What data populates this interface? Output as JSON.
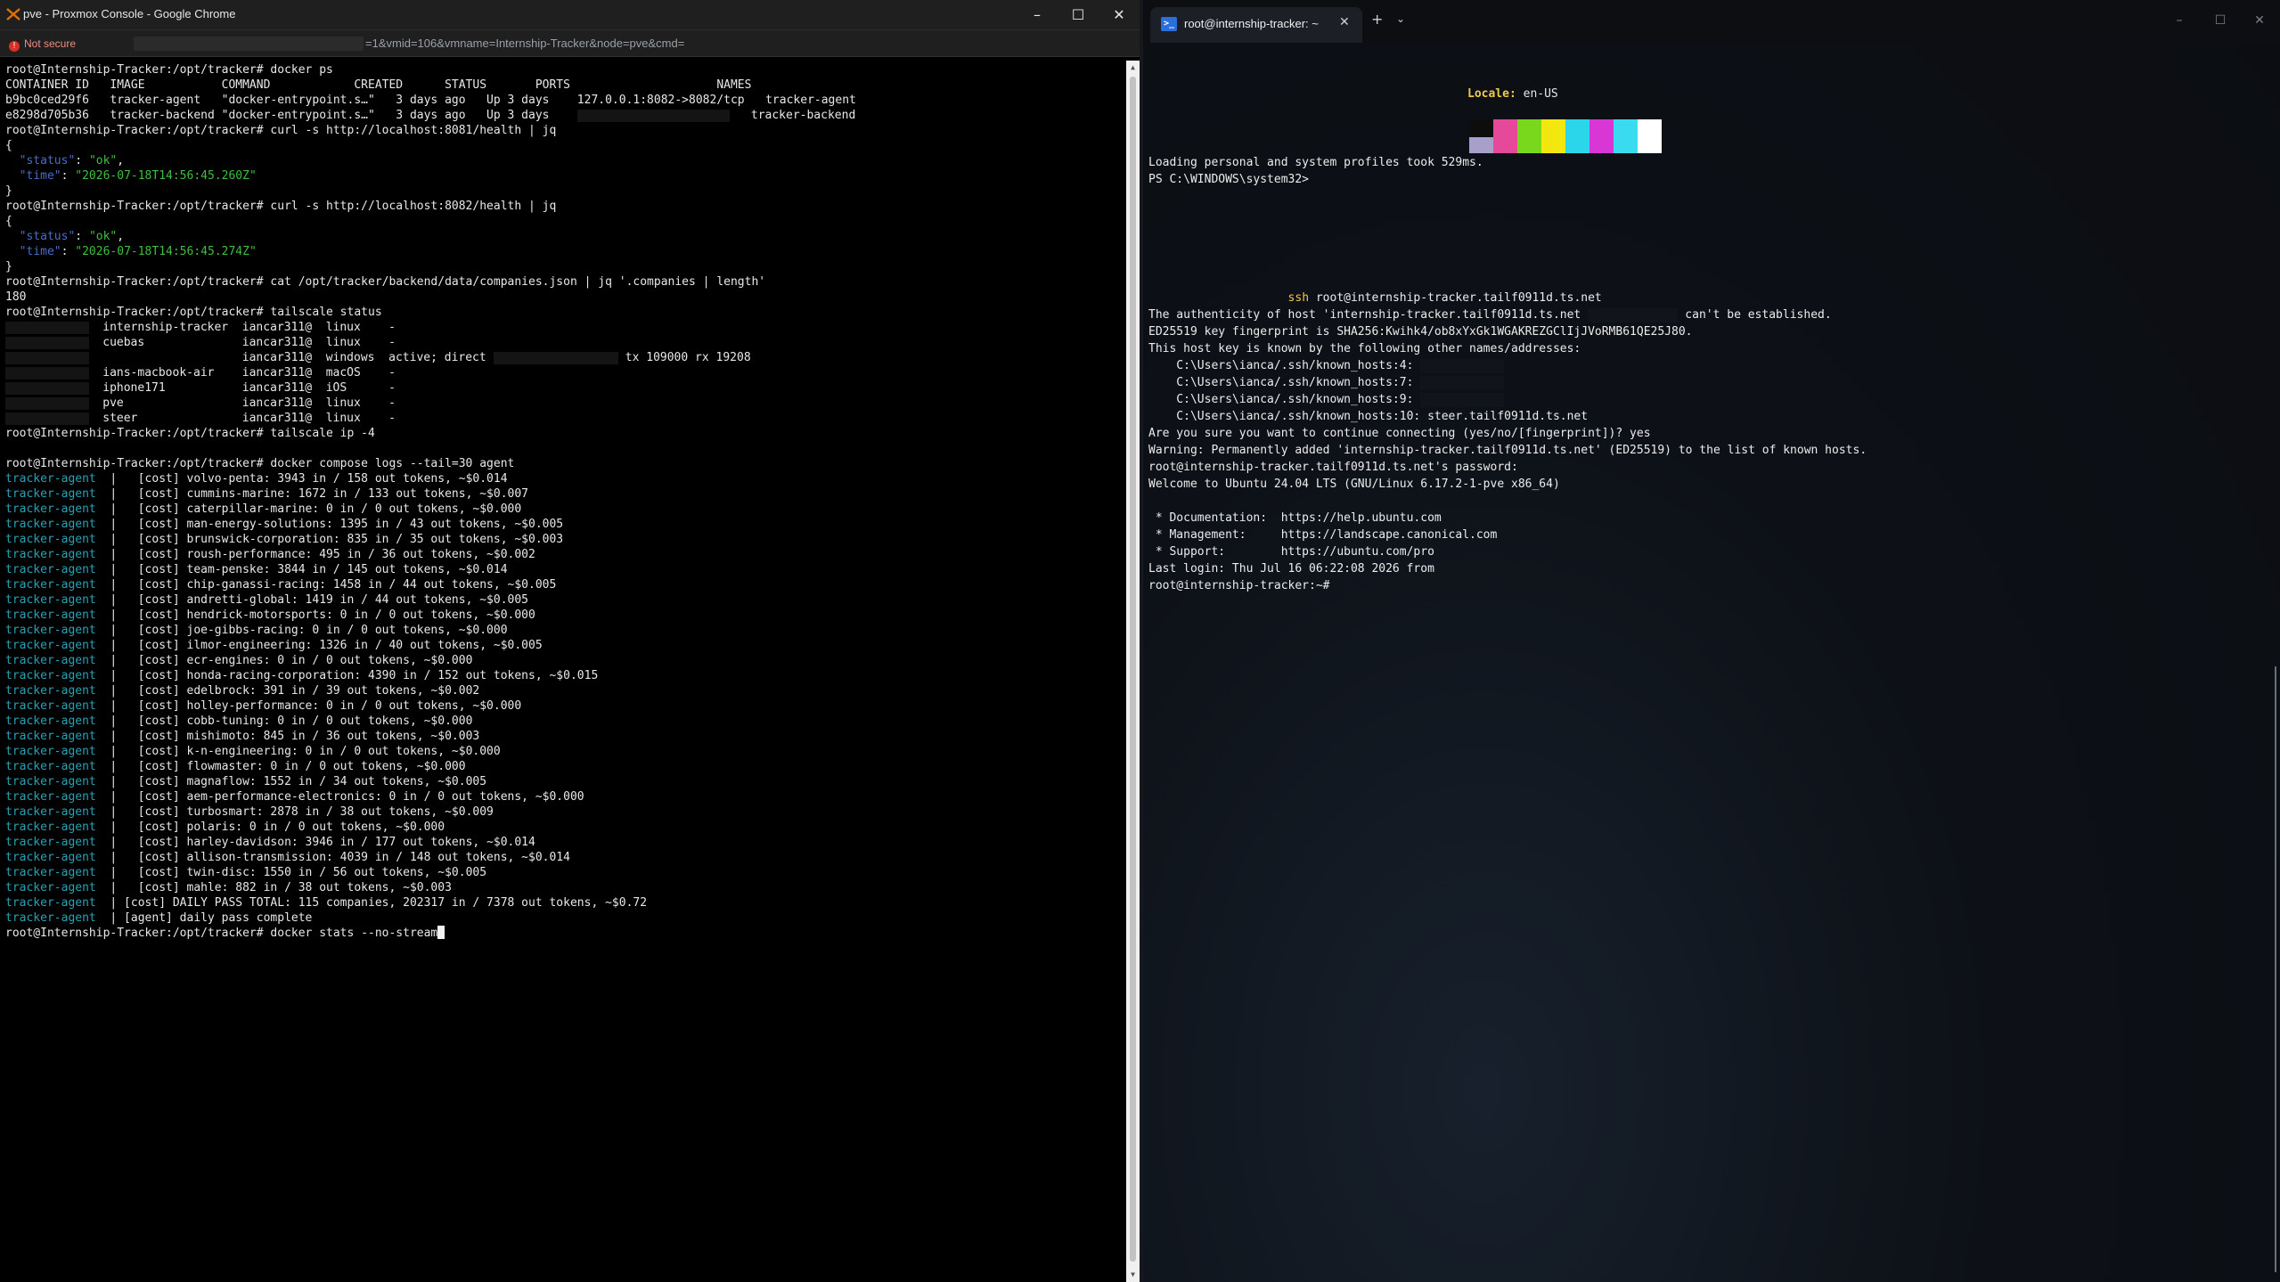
{
  "chrome": {
    "window_title": "pve - Proxmox Console - Google Chrome",
    "not_secure": "Not secure",
    "url_visible": "=1&vmid=106&vmname=Internship-Tracker&node=pve&cmd="
  },
  "console": {
    "lines": [
      {
        "segs": [
          {
            "t": "root@Internship-Tracker:/opt/tracker# docker ps"
          }
        ]
      },
      {
        "segs": [
          {
            "t": "CONTAINER ID   IMAGE           COMMAND            CREATED      STATUS       PORTS                     NAMES"
          }
        ]
      },
      {
        "segs": [
          {
            "t": "b9bc0ced29f6   tracker-agent   \"docker-entrypoint.s…\"   3 days ago   Up 3 days    127.0.0.1:8082->8082/tcp   tracker-agent"
          }
        ]
      },
      {
        "segs": [
          {
            "t": "e8298d705b36   tracker-backend \"docker-entrypoint.s…\"   3 days ago   Up 3 days    "
          },
          {
            "mask": 22
          },
          {
            "t": "   tracker-backend"
          }
        ]
      },
      {
        "segs": [
          {
            "t": "root@Internship-Tracker:/opt/tracker# curl -s http://localhost:8081/health | jq"
          }
        ]
      },
      {
        "segs": [
          {
            "t": "{"
          }
        ]
      },
      {
        "segs": [
          {
            "t": "  "
          },
          {
            "t": "\"status\"",
            "c": "jkey"
          },
          {
            "t": ": "
          },
          {
            "t": "\"ok\"",
            "c": "jstr"
          },
          {
            "t": ","
          }
        ]
      },
      {
        "segs": [
          {
            "t": "  "
          },
          {
            "t": "\"time\"",
            "c": "jkey"
          },
          {
            "t": ": "
          },
          {
            "t": "\"2026-07-18T14:56:45.260Z\"",
            "c": "jstr"
          }
        ]
      },
      {
        "segs": [
          {
            "t": "}"
          }
        ]
      },
      {
        "segs": [
          {
            "t": "root@Internship-Tracker:/opt/tracker# curl -s http://localhost:8082/health | jq"
          }
        ]
      },
      {
        "segs": [
          {
            "t": "{"
          }
        ]
      },
      {
        "segs": [
          {
            "t": "  "
          },
          {
            "t": "\"status\"",
            "c": "jkey"
          },
          {
            "t": ": "
          },
          {
            "t": "\"ok\"",
            "c": "jstr"
          },
          {
            "t": ","
          }
        ]
      },
      {
        "segs": [
          {
            "t": "  "
          },
          {
            "t": "\"time\"",
            "c": "jkey"
          },
          {
            "t": ": "
          },
          {
            "t": "\"2026-07-18T14:56:45.274Z\"",
            "c": "jstr"
          }
        ]
      },
      {
        "segs": [
          {
            "t": "}"
          }
        ]
      },
      {
        "segs": [
          {
            "t": "root@Internship-Tracker:/opt/tracker# cat /opt/tracker/backend/data/companies.json | jq '.companies | length'"
          }
        ]
      },
      {
        "segs": [
          {
            "t": "180"
          }
        ]
      },
      {
        "segs": [
          {
            "t": "root@Internship-Tracker:/opt/tracker# tailscale status"
          }
        ]
      },
      {
        "segs": [
          {
            "mask": 12
          },
          {
            "t": "  internship-tracker  iancar311@  linux    -"
          }
        ]
      },
      {
        "segs": [
          {
            "mask": 12
          },
          {
            "t": "  cuebas              iancar311@  linux    -"
          }
        ]
      },
      {
        "segs": [
          {
            "mask": 12
          },
          {
            "t": "                      iancar311@  windows  active; direct "
          },
          {
            "mask": 18
          },
          {
            "t": " tx 109000 rx 19208"
          }
        ]
      },
      {
        "segs": [
          {
            "mask": 12
          },
          {
            "t": "  ians-macbook-air    iancar311@  macOS    -"
          }
        ]
      },
      {
        "segs": [
          {
            "mask": 12
          },
          {
            "t": "  iphone171           iancar311@  iOS      -"
          }
        ]
      },
      {
        "segs": [
          {
            "mask": 12
          },
          {
            "t": "  pve                 iancar311@  linux    -"
          }
        ]
      },
      {
        "segs": [
          {
            "mask": 12
          },
          {
            "t": "  steer               iancar311@  linux    -"
          }
        ]
      },
      {
        "segs": [
          {
            "t": "root@Internship-Tracker:/opt/tracker# tailscale ip -4"
          }
        ]
      },
      {
        "segs": [
          {
            "t": ""
          }
        ]
      },
      {
        "segs": [
          {
            "t": "root@Internship-Tracker:/opt/tracker# docker compose logs --tail=30 agent"
          }
        ]
      },
      {
        "segs": [
          {
            "t": "tracker-agent",
            "c": "agent"
          },
          {
            "t": "  |   [cost] volvo-penta: 3943 in / 158 out tokens, ~$0.014"
          }
        ]
      },
      {
        "segs": [
          {
            "t": "tracker-agent",
            "c": "agent"
          },
          {
            "t": "  |   [cost] cummins-marine: 1672 in / 133 out tokens, ~$0.007"
          }
        ]
      },
      {
        "segs": [
          {
            "t": "tracker-agent",
            "c": "agent"
          },
          {
            "t": "  |   [cost] caterpillar-marine: 0 in / 0 out tokens, ~$0.000"
          }
        ]
      },
      {
        "segs": [
          {
            "t": "tracker-agent",
            "c": "agent"
          },
          {
            "t": "  |   [cost] man-energy-solutions: 1395 in / 43 out tokens, ~$0.005"
          }
        ]
      },
      {
        "segs": [
          {
            "t": "tracker-agent",
            "c": "agent"
          },
          {
            "t": "  |   [cost] brunswick-corporation: 835 in / 35 out tokens, ~$0.003"
          }
        ]
      },
      {
        "segs": [
          {
            "t": "tracker-agent",
            "c": "agent"
          },
          {
            "t": "  |   [cost] roush-performance: 495 in / 36 out tokens, ~$0.002"
          }
        ]
      },
      {
        "segs": [
          {
            "t": "tracker-agent",
            "c": "agent"
          },
          {
            "t": "  |   [cost] team-penske: 3844 in / 145 out tokens, ~$0.014"
          }
        ]
      },
      {
        "segs": [
          {
            "t": "tracker-agent",
            "c": "agent"
          },
          {
            "t": "  |   [cost] chip-ganassi-racing: 1458 in / 44 out tokens, ~$0.005"
          }
        ]
      },
      {
        "segs": [
          {
            "t": "tracker-agent",
            "c": "agent"
          },
          {
            "t": "  |   [cost] andretti-global: 1419 in / 44 out tokens, ~$0.005"
          }
        ]
      },
      {
        "segs": [
          {
            "t": "tracker-agent",
            "c": "agent"
          },
          {
            "t": "  |   [cost] hendrick-motorsports: 0 in / 0 out tokens, ~$0.000"
          }
        ]
      },
      {
        "segs": [
          {
            "t": "tracker-agent",
            "c": "agent"
          },
          {
            "t": "  |   [cost] joe-gibbs-racing: 0 in / 0 out tokens, ~$0.000"
          }
        ]
      },
      {
        "segs": [
          {
            "t": "tracker-agent",
            "c": "agent"
          },
          {
            "t": "  |   [cost] ilmor-engineering: 1326 in / 40 out tokens, ~$0.005"
          }
        ]
      },
      {
        "segs": [
          {
            "t": "tracker-agent",
            "c": "agent"
          },
          {
            "t": "  |   [cost] ecr-engines: 0 in / 0 out tokens, ~$0.000"
          }
        ]
      },
      {
        "segs": [
          {
            "t": "tracker-agent",
            "c": "agent"
          },
          {
            "t": "  |   [cost] honda-racing-corporation: 4390 in / 152 out tokens, ~$0.015"
          }
        ]
      },
      {
        "segs": [
          {
            "t": "tracker-agent",
            "c": "agent"
          },
          {
            "t": "  |   [cost] edelbrock: 391 in / 39 out tokens, ~$0.002"
          }
        ]
      },
      {
        "segs": [
          {
            "t": "tracker-agent",
            "c": "agent"
          },
          {
            "t": "  |   [cost] holley-performance: 0 in / 0 out tokens, ~$0.000"
          }
        ]
      },
      {
        "segs": [
          {
            "t": "tracker-agent",
            "c": "agent"
          },
          {
            "t": "  |   [cost] cobb-tuning: 0 in / 0 out tokens, ~$0.000"
          }
        ]
      },
      {
        "segs": [
          {
            "t": "tracker-agent",
            "c": "agent"
          },
          {
            "t": "  |   [cost] mishimoto: 845 in / 36 out tokens, ~$0.003"
          }
        ]
      },
      {
        "segs": [
          {
            "t": "tracker-agent",
            "c": "agent"
          },
          {
            "t": "  |   [cost] k-n-engineering: 0 in / 0 out tokens, ~$0.000"
          }
        ]
      },
      {
        "segs": [
          {
            "t": "tracker-agent",
            "c": "agent"
          },
          {
            "t": "  |   [cost] flowmaster: 0 in / 0 out tokens, ~$0.000"
          }
        ]
      },
      {
        "segs": [
          {
            "t": "tracker-agent",
            "c": "agent"
          },
          {
            "t": "  |   [cost] magnaflow: 1552 in / 34 out tokens, ~$0.005"
          }
        ]
      },
      {
        "segs": [
          {
            "t": "tracker-agent",
            "c": "agent"
          },
          {
            "t": "  |   [cost] aem-performance-electronics: 0 in / 0 out tokens, ~$0.000"
          }
        ]
      },
      {
        "segs": [
          {
            "t": "tracker-agent",
            "c": "agent"
          },
          {
            "t": "  |   [cost] turbosmart: 2878 in / 38 out tokens, ~$0.009"
          }
        ]
      },
      {
        "segs": [
          {
            "t": "tracker-agent",
            "c": "agent"
          },
          {
            "t": "  |   [cost] polaris: 0 in / 0 out tokens, ~$0.000"
          }
        ]
      },
      {
        "segs": [
          {
            "t": "tracker-agent",
            "c": "agent"
          },
          {
            "t": "  |   [cost] harley-davidson: 3946 in / 177 out tokens, ~$0.014"
          }
        ]
      },
      {
        "segs": [
          {
            "t": "tracker-agent",
            "c": "agent"
          },
          {
            "t": "  |   [cost] allison-transmission: 4039 in / 148 out tokens, ~$0.014"
          }
        ]
      },
      {
        "segs": [
          {
            "t": "tracker-agent",
            "c": "agent"
          },
          {
            "t": "  |   [cost] twin-disc: 1550 in / 56 out tokens, ~$0.005"
          }
        ]
      },
      {
        "segs": [
          {
            "t": "tracker-agent",
            "c": "agent"
          },
          {
            "t": "  |   [cost] mahle: 882 in / 38 out tokens, ~$0.003"
          }
        ]
      },
      {
        "segs": [
          {
            "t": "tracker-agent",
            "c": "agent"
          },
          {
            "t": "  | [cost] DAILY PASS TOTAL: 115 companies, 202317 in / 7378 out tokens, ~$0.72"
          }
        ]
      },
      {
        "segs": [
          {
            "t": "tracker-agent",
            "c": "agent"
          },
          {
            "t": "  | [agent] daily pass complete"
          }
        ]
      },
      {
        "segs": [
          {
            "t": "root@Internship-Tracker:/opt/tracker# docker stats --no-stream"
          },
          {
            "cursor": true
          }
        ]
      }
    ]
  },
  "terminal": {
    "tab_title": "root@internship-tracker: ~",
    "tab_icon": "powershell-icon",
    "locale_label": "Locale:",
    "locale_value": "en-US",
    "swatch_colors": [
      "#0d0d0d",
      "#e6489a",
      "#7ad81c",
      "#f2e70f",
      "#2bd6ea",
      "#d837d6",
      "#39dcef",
      "#ffffff"
    ],
    "swatch_under": "#a8a0c8",
    "lines": [
      {
        "segs": [
          {
            "t": "Loading personal and system profiles took 529ms."
          }
        ]
      },
      {
        "segs": [
          {
            "t": "PS C:\\WINDOWS\\system32>"
          }
        ]
      },
      {
        "segs": [
          {
            "t": ""
          }
        ]
      },
      {
        "segs": [
          {
            "t": ""
          }
        ]
      },
      {
        "segs": [
          {
            "t": ""
          }
        ]
      },
      {
        "segs": [
          {
            "t": ""
          }
        ]
      },
      {
        "segs": [
          {
            "t": ""
          }
        ]
      },
      {
        "segs": [
          {
            "t": ""
          }
        ]
      },
      {
        "segs": [
          {
            "t": "                    "
          },
          {
            "t": "ssh",
            "c": "ssh-kw"
          },
          {
            "t": " root@internship-tracker.tailf0911d.ts.net"
          }
        ]
      },
      {
        "segs": [
          {
            "t": "The authenticity of host 'internship-tracker.tailf0911d.ts.net "
          },
          {
            "mask": 13
          },
          {
            "t": " can't be established."
          }
        ]
      },
      {
        "segs": [
          {
            "t": "ED25519 key fingerprint is SHA256:Kwihk4/ob8xYxGk1WGAKREZGClIjJVoRMB61QE25J80."
          }
        ]
      },
      {
        "segs": [
          {
            "t": "This host key is known by the following other names/addresses:"
          }
        ]
      },
      {
        "segs": [
          {
            "t": "    C:\\Users\\ianca/.ssh/known_hosts:4: "
          },
          {
            "mask": 12
          }
        ]
      },
      {
        "segs": [
          {
            "t": "    C:\\Users\\ianca/.ssh/known_hosts:7: "
          },
          {
            "mask": 12
          }
        ]
      },
      {
        "segs": [
          {
            "t": "    C:\\Users\\ianca/.ssh/known_hosts:9: "
          },
          {
            "mask": 12
          }
        ]
      },
      {
        "segs": [
          {
            "t": "    C:\\Users\\ianca/.ssh/known_hosts:10: steer.tailf0911d.ts.net"
          }
        ]
      },
      {
        "segs": [
          {
            "t": "Are you sure you want to continue connecting (yes/no/[fingerprint])? yes"
          }
        ]
      },
      {
        "segs": [
          {
            "t": "Warning: Permanently added 'internship-tracker.tailf0911d.ts.net' (ED25519) to the list of known hosts."
          }
        ]
      },
      {
        "segs": [
          {
            "t": "root@internship-tracker.tailf0911d.ts.net's password:"
          }
        ]
      },
      {
        "segs": [
          {
            "t": "Welcome to Ubuntu 24.04 LTS (GNU/Linux 6.17.2-1-pve x86_64)"
          }
        ]
      },
      {
        "segs": [
          {
            "t": ""
          }
        ]
      },
      {
        "segs": [
          {
            "t": " * Documentation:  https://help.ubuntu.com"
          }
        ]
      },
      {
        "segs": [
          {
            "t": " * Management:     https://landscape.canonical.com"
          }
        ]
      },
      {
        "segs": [
          {
            "t": " * Support:        https://ubuntu.com/pro"
          }
        ]
      },
      {
        "segs": [
          {
            "t": "Last login: Thu Jul 16 06:22:08 2026 from "
          },
          {
            "mask": 10
          }
        ]
      },
      {
        "segs": [
          {
            "t": "root@internship-tracker:~#"
          }
        ]
      }
    ]
  }
}
